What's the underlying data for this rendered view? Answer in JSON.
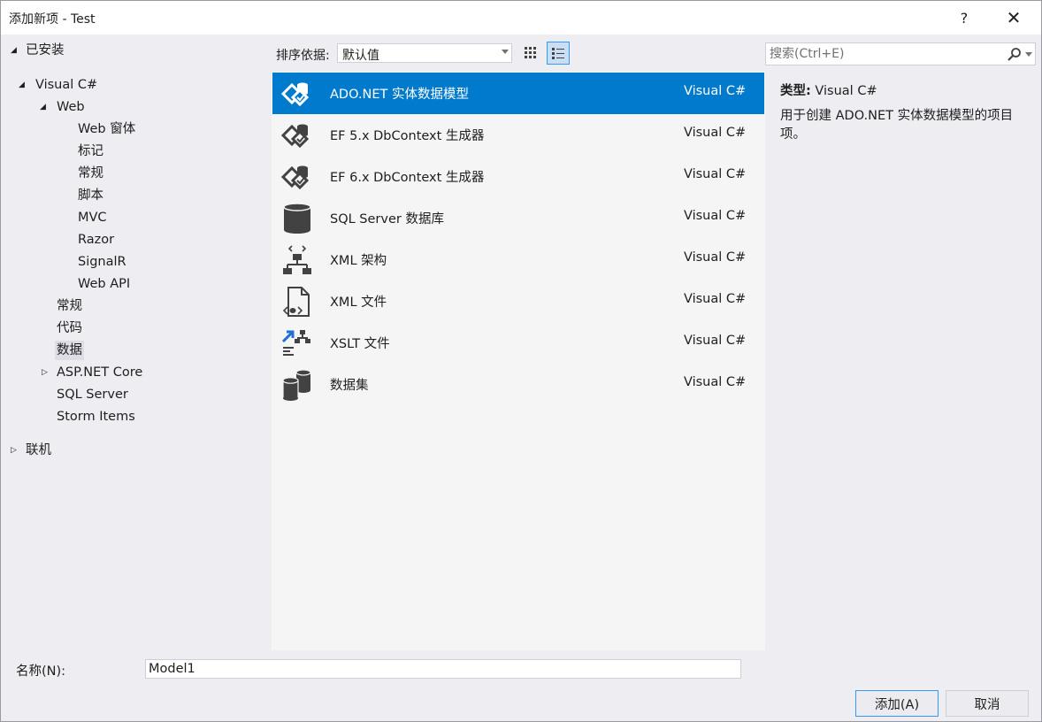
{
  "window": {
    "title": "添加新项 - Test",
    "help_label": "?",
    "close_label": "✕"
  },
  "tree": {
    "installed": "已安装",
    "visual_csharp": "Visual C#",
    "web": "Web",
    "web_children": [
      "Web 窗体",
      "标记",
      "常规",
      "脚本",
      "MVC",
      "Razor",
      "SignalR",
      "Web API"
    ],
    "general": "常规",
    "code": "代码",
    "data": "数据",
    "aspnet_core": "ASP.NET Core",
    "sql_server": "SQL Server",
    "storm_items": "Storm Items",
    "online": "联机"
  },
  "toolbar": {
    "sort_label": "排序依据:",
    "sort_value": "默认值"
  },
  "search": {
    "placeholder": "搜索(Ctrl+E)"
  },
  "templates": [
    {
      "name": "ADO.NET 实体数据模型",
      "lang": "Visual C#",
      "icon": "entity-model-icon"
    },
    {
      "name": "EF 5.x DbContext 生成器",
      "lang": "Visual C#",
      "icon": "dbcontext-generator-icon"
    },
    {
      "name": "EF 6.x DbContext 生成器",
      "lang": "Visual C#",
      "icon": "dbcontext-generator-icon"
    },
    {
      "name": "SQL Server 数据库",
      "lang": "Visual C#",
      "icon": "database-icon"
    },
    {
      "name": "XML 架构",
      "lang": "Visual C#",
      "icon": "xml-schema-icon"
    },
    {
      "name": "XML 文件",
      "lang": "Visual C#",
      "icon": "xml-file-icon"
    },
    {
      "name": "XSLT 文件",
      "lang": "Visual C#",
      "icon": "xslt-file-icon"
    },
    {
      "name": "数据集",
      "lang": "Visual C#",
      "icon": "dataset-icon"
    }
  ],
  "description": {
    "type_label": "类型:",
    "type_value": "Visual C#",
    "text": "用于创建 ADO.NET 实体数据模型的项目项。"
  },
  "name_field": {
    "label": "名称(N):",
    "value": "Model1"
  },
  "buttons": {
    "add": "添加(A)",
    "cancel": "取消"
  },
  "colors": {
    "selected_row": "#007acc",
    "dialog_bg": "#eeeef2",
    "list_bg": "#f5f5f5"
  }
}
